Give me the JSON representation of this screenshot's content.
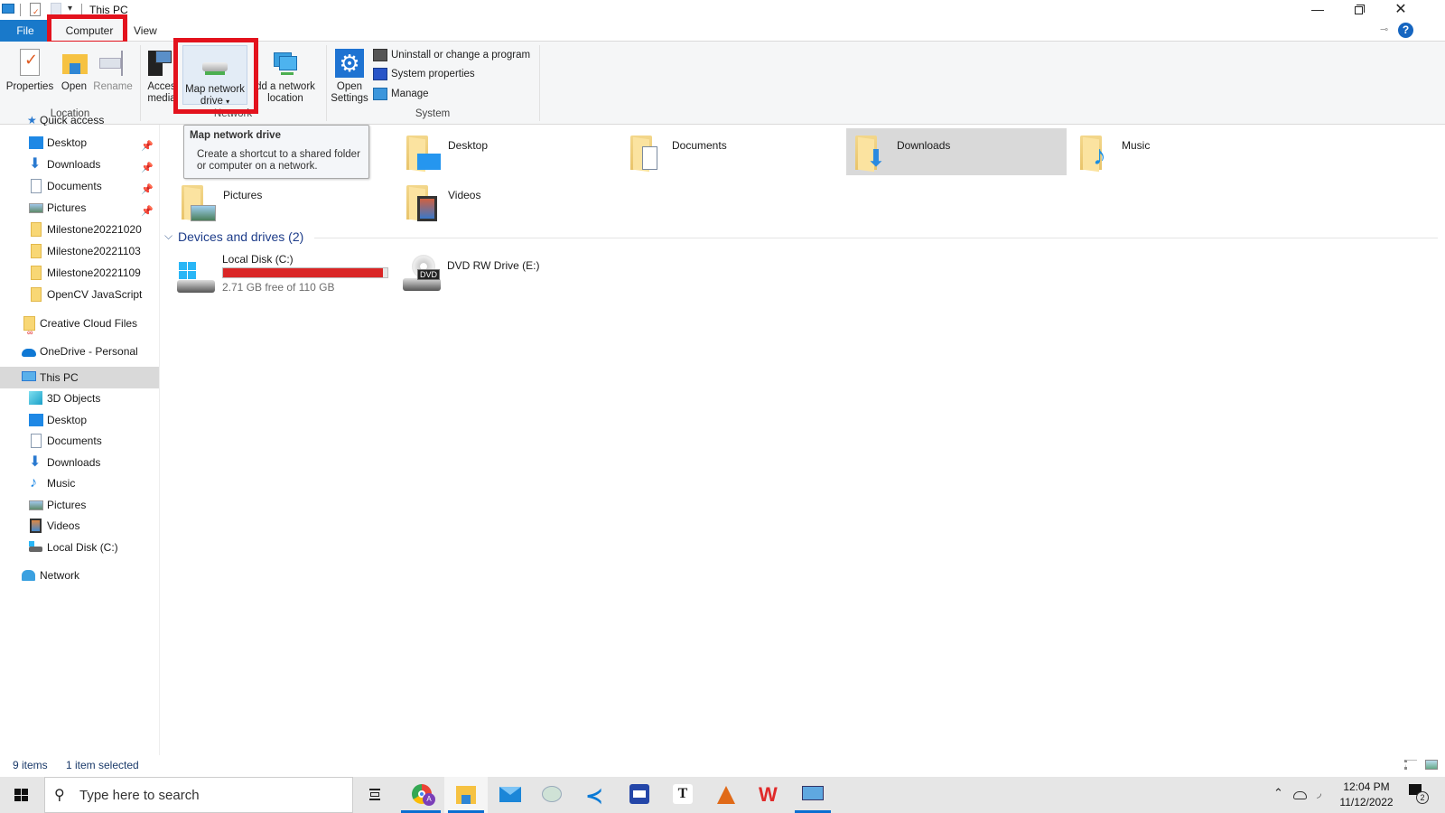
{
  "window": {
    "title": "This PC",
    "controls": {
      "minimize": "minimize-icon",
      "restore": "restore-icon",
      "close": "close-icon"
    }
  },
  "ribbon_tabs": [
    {
      "label": "File",
      "active": false
    },
    {
      "label": "Computer",
      "active": true,
      "highlighted": true
    },
    {
      "label": "View",
      "active": false
    }
  ],
  "ribbon": {
    "groups": {
      "location": {
        "label": "Location",
        "buttons": [
          {
            "label": "Properties",
            "icon": "properties-icon"
          },
          {
            "label": "Open",
            "icon": "open-folder-icon"
          },
          {
            "label": "Rename",
            "icon": "rename-icon",
            "disabled": true
          }
        ]
      },
      "network": {
        "label": "Network",
        "buttons": [
          {
            "label_line1": "Access",
            "label_line2": "media",
            "visible_line1": "Acces",
            "visible_line2": "media",
            "icon": "access-media-icon"
          },
          {
            "label_line1": "Map network",
            "label_line2": "drive",
            "icon": "map-network-drive-icon",
            "dropdown": true,
            "highlighted": true
          },
          {
            "label_line1": "Add a network",
            "label_line2": "location",
            "visible_line1": "dd a network",
            "visible_line2": "location",
            "icon": "network-location-icon"
          }
        ]
      },
      "system": {
        "label": "System",
        "open_settings": {
          "label_line1": "Open",
          "label_line2": "Settings",
          "icon": "settings-gear-icon"
        },
        "items": [
          {
            "label": "Uninstall or change a program",
            "icon": "uninstall-icon"
          },
          {
            "label": "System properties",
            "icon": "system-properties-icon"
          },
          {
            "label": "Manage",
            "icon": "manage-icon"
          }
        ]
      }
    }
  },
  "tooltip": {
    "title": "Map network drive",
    "line1": "Create a shortcut to a shared folder",
    "line2": "or computer on a network."
  },
  "nav": {
    "quick_access_label": "Quick access",
    "quick_access": [
      {
        "label": "Desktop",
        "icon": "desktop-icon",
        "pinned": true
      },
      {
        "label": "Downloads",
        "icon": "downloads-icon",
        "pinned": true
      },
      {
        "label": "Documents",
        "icon": "documents-icon",
        "pinned": true
      },
      {
        "label": "Pictures",
        "icon": "pictures-icon",
        "pinned": true
      },
      {
        "label": "Milestone20221020",
        "icon": "folder-icon"
      },
      {
        "label": "Milestone20221103",
        "icon": "folder-icon"
      },
      {
        "label": "Milestone20221109",
        "icon": "folder-icon"
      },
      {
        "label": "OpenCV JavaScript",
        "icon": "folder-icon"
      }
    ],
    "creative_cloud": "Creative Cloud Files",
    "onedrive": "OneDrive - Personal",
    "this_pc": "This PC",
    "this_pc_items": [
      {
        "label": "3D Objects",
        "icon": "3d-objects-icon"
      },
      {
        "label": "Desktop",
        "icon": "desktop-icon"
      },
      {
        "label": "Documents",
        "icon": "documents-icon"
      },
      {
        "label": "Downloads",
        "icon": "downloads-icon"
      },
      {
        "label": "Music",
        "icon": "music-icon"
      },
      {
        "label": "Pictures",
        "icon": "pictures-icon"
      },
      {
        "label": "Videos",
        "icon": "videos-icon"
      },
      {
        "label": "Local Disk (C:)",
        "icon": "local-disk-icon"
      }
    ],
    "network": "Network"
  },
  "content": {
    "folders": [
      {
        "label": "Desktop",
        "overlay": "desktop"
      },
      {
        "label": "Documents",
        "overlay": "documents"
      },
      {
        "label": "Downloads",
        "overlay": "downloads",
        "selected": true
      },
      {
        "label": "Music",
        "overlay": "music"
      },
      {
        "label": "Pictures",
        "overlay": "pictures"
      },
      {
        "label": "Videos",
        "overlay": "videos"
      }
    ],
    "devices_header": "Devices and drives (2)",
    "drives": [
      {
        "label": "Local Disk (C:)",
        "free_text": "2.71 GB free of 110 GB",
        "used_fraction": 0.975,
        "bar_color": "#da2626"
      },
      {
        "label": "DVD RW Drive (E:)",
        "badge": "DVD"
      }
    ]
  },
  "status": {
    "items": "9 items",
    "selected": "1 item selected"
  },
  "taskbar": {
    "search_placeholder": "Type here to search",
    "apps": [
      {
        "name": "task-view",
        "active": false
      },
      {
        "name": "chrome",
        "active": false,
        "running": true,
        "badge": "A"
      },
      {
        "name": "file-explorer",
        "active": true,
        "running": true
      },
      {
        "name": "mail",
        "active": false
      },
      {
        "name": "paint",
        "active": false
      },
      {
        "name": "vscode",
        "active": false
      },
      {
        "name": "scanner",
        "active": false
      },
      {
        "name": "typora",
        "active": false,
        "glyph": "T"
      },
      {
        "name": "matlab",
        "active": false
      },
      {
        "name": "wps-office",
        "active": false
      },
      {
        "name": "remote-desktop",
        "active": false,
        "running": true
      }
    ],
    "time": "12:04 PM",
    "date": "11/12/2022",
    "notification_count": "2"
  },
  "colors": {
    "accent": "#1979ca",
    "highlight_red": "#e3121d",
    "selection": "#d9d9d9"
  }
}
